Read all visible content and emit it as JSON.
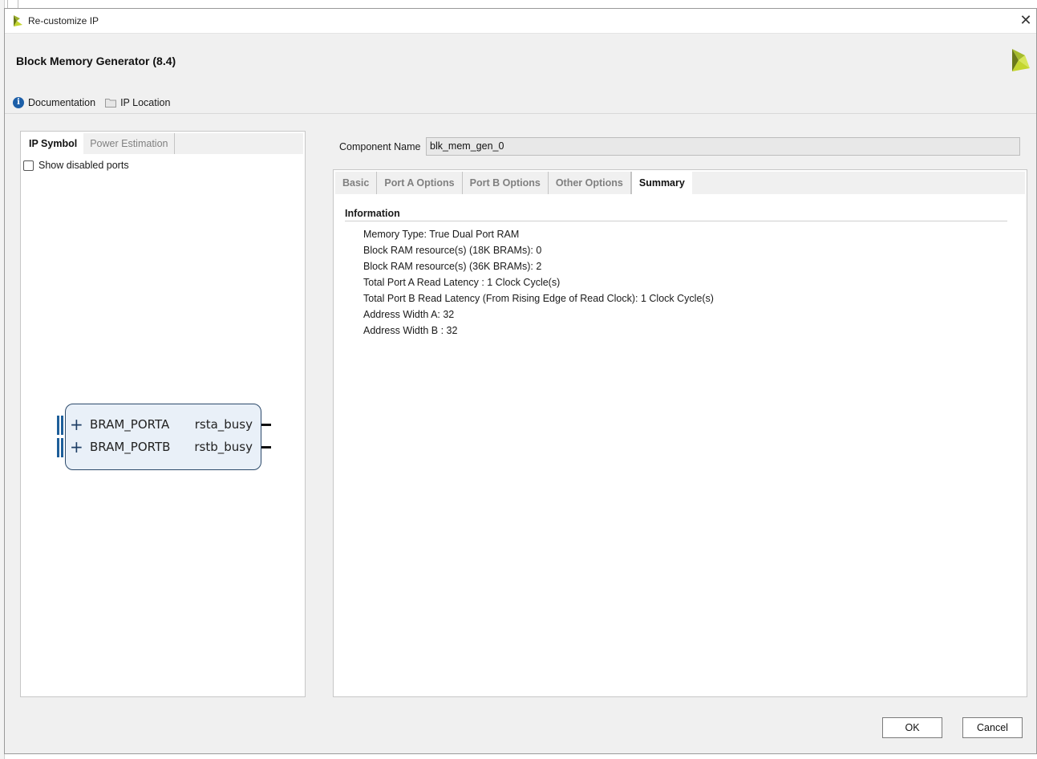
{
  "window": {
    "title": "Re-customize IP",
    "close_glyph": "✕"
  },
  "header": {
    "heading": "Block Memory Generator (8.4)"
  },
  "toolbar": {
    "documentation_label": "Documentation",
    "ip_location_label": "IP Location"
  },
  "left_panel": {
    "tabs": [
      {
        "label": "IP Symbol",
        "active": true
      },
      {
        "label": "Power Estimation",
        "active": false
      }
    ],
    "show_disabled_ports_label": "Show disabled ports",
    "show_disabled_ports_checked": false,
    "ip_symbol": {
      "ports": [
        {
          "interface": "BRAM_PORTA",
          "signal": "rsta_busy"
        },
        {
          "interface": "BRAM_PORTB",
          "signal": "rstb_busy"
        }
      ]
    }
  },
  "component": {
    "label": "Component Name",
    "value": "blk_mem_gen_0"
  },
  "right_panel": {
    "tabs": [
      {
        "label": "Basic",
        "active": false
      },
      {
        "label": "Port A Options",
        "active": false
      },
      {
        "label": "Port B Options",
        "active": false
      },
      {
        "label": "Other Options",
        "active": false
      },
      {
        "label": "Summary",
        "active": true
      }
    ],
    "section_title": "Information",
    "items": [
      "Memory Type: True Dual Port RAM",
      "Block RAM resource(s) (18K BRAMs): 0",
      "Block RAM resource(s) (36K BRAMs): 2",
      "Total Port A Read Latency : 1 Clock Cycle(s)",
      "Total Port B Read Latency (From Rising Edge of Read Clock): 1 Clock Cycle(s)",
      "Address Width A: 32",
      "Address Width B : 32"
    ]
  },
  "footer": {
    "ok_label": "OK",
    "cancel_label": "Cancel"
  },
  "colors": {
    "xilinx_logo_dark": "#6b7a1a",
    "xilinx_logo_light": "#c4d62e",
    "info_icon": "#1d5fa8",
    "ip_block_fill": "#e9f0f8",
    "ip_block_border": "#2c4a6b"
  },
  "icons": {
    "title_logo": "xilinx-logo-icon",
    "header_logo": "xilinx-logo-icon",
    "documentation": "info-icon",
    "ip_location": "folder-icon"
  }
}
